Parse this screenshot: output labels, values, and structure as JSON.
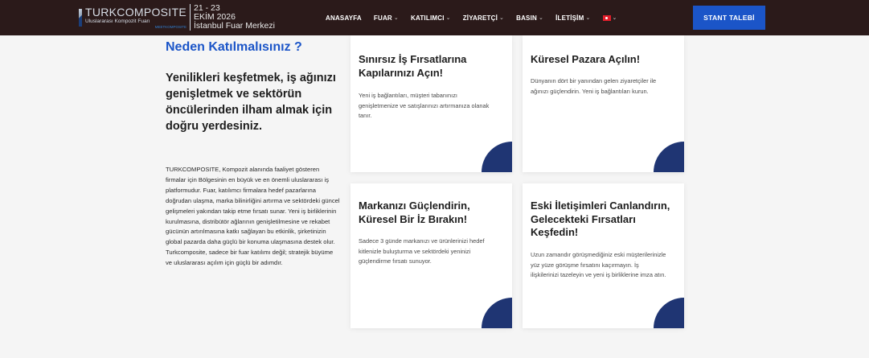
{
  "header": {
    "logo": {
      "brand": "TURKCOMPOSITE",
      "subtitle": "Uluslararası Kompozit Fuarı",
      "tagline": "MEETKOMPOSITE"
    },
    "event": {
      "dates": "21 - 23",
      "month_year": "EKİM 2026",
      "venue": "İstanbul Fuar Merkezi"
    },
    "nav": [
      {
        "label": "ANASAYFA",
        "has_dropdown": false
      },
      {
        "label": "FUAR",
        "has_dropdown": true
      },
      {
        "label": "KATILIMCI",
        "has_dropdown": true
      },
      {
        "label": "ZİYARETÇİ",
        "has_dropdown": true
      },
      {
        "label": "BASIN",
        "has_dropdown": true
      },
      {
        "label": "İLETİŞİM",
        "has_dropdown": true
      }
    ],
    "language_icon": "turkey-flag-icon",
    "cta_label": "STANT TALEBİ"
  },
  "main": {
    "heading": "Neden Katılmalısınız ?",
    "lead": "Yenilikleri keşfetmek, iş ağınızı genişletmek ve sektörün öncülerinden ilham almak için doğru yerdesiniz.",
    "body": "TURKCOMPOSITE, Kompozit alanında faaliyet gösteren firmalar için Bölgesinin en büyük ve en önemli uluslararası iş platformudur. Fuar, katılımcı firmalara hedef pazarlarına doğrudan ulaşma, marka bilinirliğini artırma ve sektördeki güncel gelişmeleri yakından takip etme fırsatı sunar. Yeni iş birliklerinin kurulmasına, distribütör ağlarının genişletilmesine ve rekabet gücünün artırılmasına katkı sağlayan bu etkinlik, şirketinizin global pazarda daha güçlü bir konuma ulaşmasına destek olur. Turkcomposite, sadece bir fuar katılımı değil; stratejik büyüme ve uluslararası açılım için güçlü bir adımdır."
  },
  "cards": [
    {
      "title": "Sınırsız İş Fırsatlarına Kapılarınızı Açın!",
      "text": "Yeni iş bağlantıları, müşteri tabanınızı genişletmenize ve satışlarınızı artırmanıza olanak tanır."
    },
    {
      "title": "Küresel Pazara Açılın!",
      "text": "Dünyanın dört bir yanından gelen ziyaretçiler ile ağınızı güçlendirin. Yeni iş bağlantıları kurun."
    },
    {
      "title": "Markanızı Güçlendirin, Küresel Bir İz Bırakın!",
      "text": "Sadece 3 günde markanızı ve ürünlerinizi hedef kitlenizle buluşturma ve sektördeki yeninizi güçlendirme fırsatı sunuyor."
    },
    {
      "title": "Eski İletişimleri Canlandırın, Gelecekteki Fırsatları Keşfedin!",
      "text": "Uzun zamandır görüşmediğiniz eski müşterilerinizle yüz yüze görüşme fırsatını kaçırmayın. İş ilişkilerinizi tazeleyin ve yeni iş birliklerine imza atın."
    }
  ],
  "colors": {
    "topbar": "#2b1a1a",
    "accent_blue": "#1b55c8",
    "card_corner": "#1f3573",
    "background": "#f5f5f5"
  }
}
